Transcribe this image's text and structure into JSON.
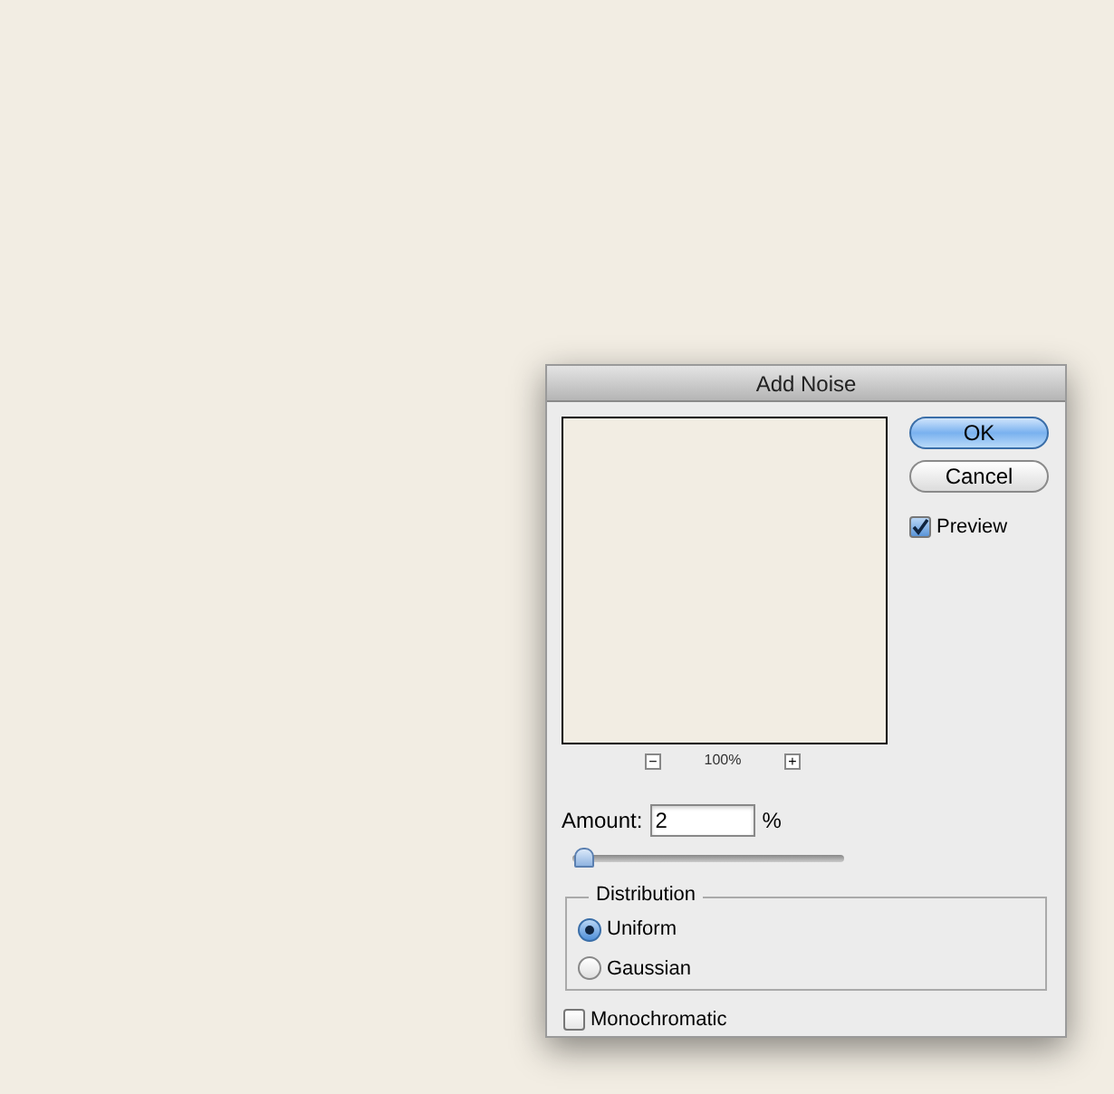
{
  "window": {
    "title": "Add Noise"
  },
  "buttons": [
    {
      "label": "OK",
      "default": true
    },
    {
      "label": "Cancel",
      "default": false
    }
  ],
  "preview": {
    "label": "Preview",
    "checked": true
  },
  "zoom": {
    "minus": "−",
    "level": "100%",
    "plus": "+"
  },
  "amount": {
    "label": "Amount:",
    "value": "2",
    "unit": "%"
  },
  "slider": {
    "level": 0.01
  },
  "distribution": {
    "legend": "Distribution",
    "options": [
      {
        "label": "Uniform",
        "selected": true
      },
      {
        "label": "Gaussian",
        "selected": false
      }
    ]
  },
  "monochromatic": {
    "label": "Monochromatic",
    "checked": false
  }
}
